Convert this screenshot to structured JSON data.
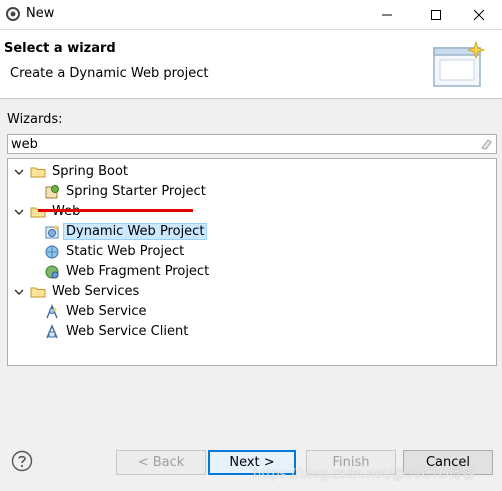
{
  "window": {
    "title": "New"
  },
  "banner": {
    "title": "Select a wizard",
    "description": "Create a Dynamic Web project"
  },
  "wizards": {
    "label": "Wizards:",
    "filter_value": "web",
    "tree": [
      {
        "label": "Spring Boot"
      },
      {
        "label": "Spring Starter Project"
      },
      {
        "label": "Web"
      },
      {
        "label": "Dynamic Web Project"
      },
      {
        "label": "Static Web Project"
      },
      {
        "label": "Web Fragment Project"
      },
      {
        "label": "Web Services"
      },
      {
        "label": "Web Service"
      },
      {
        "label": "Web Service Client"
      }
    ]
  },
  "buttons": {
    "back": "< Back",
    "next": "Next >",
    "finish": "Finish",
    "cancel": "Cancel"
  },
  "watermark": "https://blog.csdn.net/@51CTO博客",
  "colors": {
    "selection": "#cce8ff",
    "annotation_underline": "#e00000",
    "default_button_border": "#0078d7"
  }
}
